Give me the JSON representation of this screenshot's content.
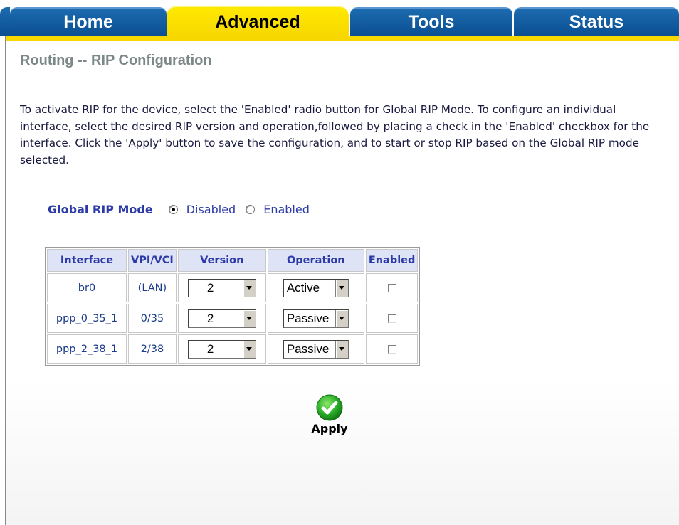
{
  "tabs": [
    {
      "label": "Home"
    },
    {
      "label": "Advanced"
    },
    {
      "label": "Tools"
    },
    {
      "label": "Status"
    }
  ],
  "active_tab": "Advanced",
  "page_title": "Routing -- RIP Configuration",
  "description": "To activate RIP for the device, select the 'Enabled' radio button for Global RIP Mode. To configure an individual interface, select the desired RIP version and operation,followed by placing a check in the 'Enabled' checkbox for the interface. Click the 'Apply' button to save the configuration, and to start or stop RIP based on the Global RIP mode selected.",
  "global_rip": {
    "label": "Global RIP Mode",
    "options": [
      "Disabled",
      "Enabled"
    ],
    "selected": "Disabled"
  },
  "table": {
    "headers": [
      "Interface",
      "VPI/VCI",
      "Version",
      "Operation",
      "Enabled"
    ],
    "rows": [
      {
        "interface": "br0",
        "vpi_vci": "(LAN)",
        "version": "2",
        "operation": "Active",
        "enabled": false
      },
      {
        "interface": "ppp_0_35_1",
        "vpi_vci": "0/35",
        "version": "2",
        "operation": "Passive",
        "enabled": false
      },
      {
        "interface": "ppp_2_38_1",
        "vpi_vci": "2/38",
        "version": "2",
        "operation": "Passive",
        "enabled": false
      }
    ]
  },
  "apply_label": "Apply",
  "colors": {
    "tab_blue": "#0a5ba4",
    "tab_active": "#f7d700",
    "title_gray": "#7c8787",
    "header_bg": "#dfe3f6",
    "header_text": "#2c3aa8",
    "apply_green": "#2bb12b"
  },
  "icons": {
    "apply": "checkmark-icon",
    "dropdown": "chevron-down-icon"
  }
}
